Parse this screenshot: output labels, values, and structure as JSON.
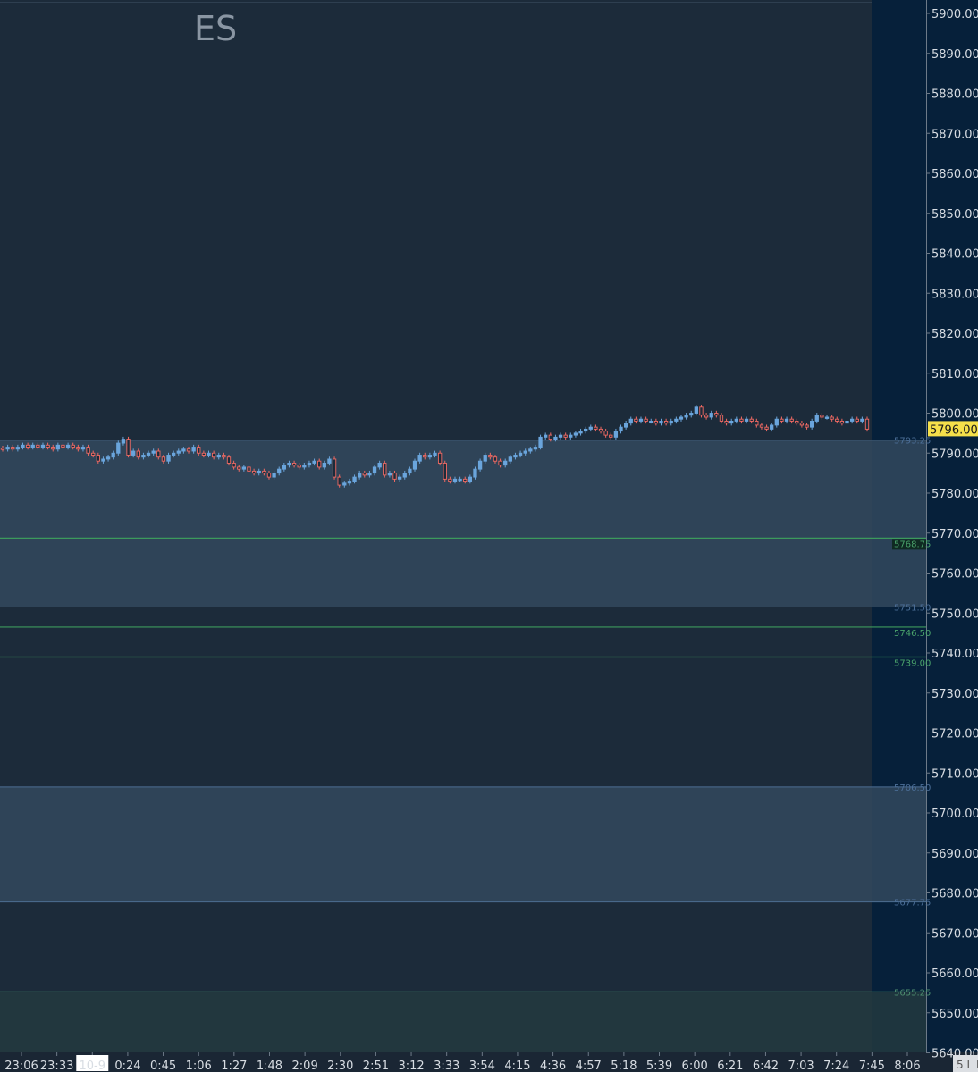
{
  "chart_data": {
    "type": "candlestick",
    "symbol": "ES",
    "current_price": "5796.00",
    "y_axis": {
      "range": [
        5640,
        5902
      ],
      "ticks": [
        "5900.00",
        "5890.00",
        "5880.00",
        "5870.00",
        "5860.00",
        "5850.00",
        "5840.00",
        "5830.00",
        "5820.00",
        "5810.00",
        "5800.00",
        "5790.00",
        "5780.00",
        "5770.00",
        "5760.00",
        "5750.00",
        "5740.00",
        "5730.00",
        "5720.00",
        "5710.00",
        "5700.00",
        "5690.00",
        "5680.00",
        "5670.00",
        "5660.00",
        "5650.00",
        "5640.00"
      ]
    },
    "x_axis": {
      "ticks": [
        "23:06",
        "23:33",
        "10-9",
        "0:24",
        "0:45",
        "1:06",
        "1:27",
        "1:48",
        "2:09",
        "2:30",
        "2:51",
        "3:12",
        "3:33",
        "3:54",
        "4:15",
        "4:36",
        "4:57",
        "5:18",
        "5:39",
        "6:00",
        "6:21",
        "6:42",
        "7:03",
        "7:24",
        "7:45",
        "8:06"
      ],
      "highlighted_tick": "10-9",
      "corner_text": "5 L I"
    },
    "zones": [
      {
        "top": 5793.25,
        "bottom": 5751.5,
        "top_label": "5793.25",
        "bottom_label": "5751.50",
        "color": "#33495e"
      },
      {
        "top": 5706.5,
        "bottom": 5677.75,
        "top_label": "5706.50",
        "bottom_label": "5677.75",
        "color": "#33495e"
      },
      {
        "top": 5655.25,
        "bottom": 5640.0,
        "top_label": "5655.25",
        "bottom_label": "",
        "color": "#23393f"
      }
    ],
    "levels": [
      {
        "price": 5768.75,
        "label": "5768.75",
        "color": "#3c9a5c"
      },
      {
        "price": 5746.5,
        "label": "5746.50",
        "color": "#3c9a5c"
      },
      {
        "price": 5739.0,
        "label": "5739.00",
        "color": "#3c9a5c"
      }
    ],
    "candle_closes": [
      5791,
      5791.5,
      5791,
      5791.5,
      5792,
      5791.5,
      5792,
      5791.5,
      5792,
      5791.5,
      5791,
      5792,
      5791.5,
      5792,
      5791.5,
      5791,
      5791.5,
      5790,
      5789.5,
      5788,
      5788.5,
      5789,
      5790,
      5792.5,
      5793.5,
      5789.5,
      5790.5,
      5789,
      5789.5,
      5790,
      5790.5,
      5789,
      5788,
      5789.5,
      5790,
      5790.5,
      5791,
      5790.5,
      5791.5,
      5790,
      5789.5,
      5790,
      5789,
      5789.5,
      5789,
      5787.5,
      5786.5,
      5786,
      5786.5,
      5785.5,
      5785,
      5785.5,
      5785,
      5784,
      5785,
      5786,
      5787,
      5787.5,
      5787,
      5786.5,
      5787,
      5787.5,
      5788,
      5786.5,
      5787.5,
      5788.5,
      5784,
      5782,
      5782.5,
      5783,
      5784,
      5785,
      5784.5,
      5785,
      5786.5,
      5787.5,
      5784.5,
      5785,
      5783.5,
      5784,
      5785,
      5786,
      5788,
      5789.5,
      5789,
      5789.5,
      5790,
      5787.5,
      5783.5,
      5783,
      5783.5,
      5783.5,
      5783,
      5784,
      5786,
      5788,
      5789.5,
      5789,
      5788,
      5787,
      5788,
      5789,
      5789.5,
      5790,
      5790.5,
      5791,
      5791.5,
      5794,
      5794.5,
      5793.5,
      5794,
      5794.5,
      5794,
      5794.5,
      5795,
      5795.5,
      5796,
      5796.5,
      5796,
      5795.5,
      5794.5,
      5794,
      5795.5,
      5796.5,
      5797.5,
      5798.5,
      5798,
      5798.5,
      5798,
      5798,
      5797.5,
      5798,
      5797.5,
      5798,
      5798.5,
      5799,
      5799.5,
      5800,
      5801.5,
      5799.5,
      5799,
      5800,
      5799.5,
      5798,
      5797.5,
      5798,
      5798.5,
      5798,
      5798.5,
      5798,
      5797,
      5796.5,
      5796,
      5797,
      5798.5,
      5798,
      5798.5,
      5798,
      5797.5,
      5797,
      5796.5,
      5798,
      5799.5,
      5799,
      5799,
      5798.5,
      5798,
      5797.5,
      5798,
      5798.5,
      5798,
      5798.5,
      5796
    ]
  }
}
